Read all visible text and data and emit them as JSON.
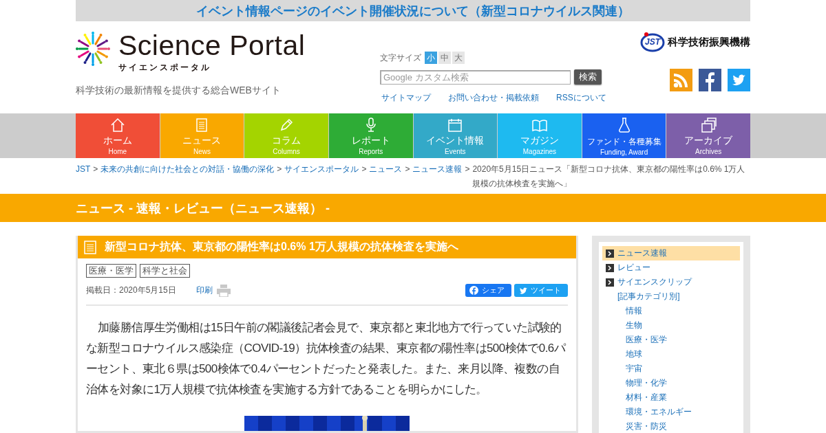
{
  "notice_banner": "イベント情報ページのイベント開催状況について（新型コロナウイルス関連）",
  "header": {
    "logo_title": "Science Portal",
    "logo_subtitle": "サイエンスポータル",
    "tagline": "科学技術の最新情報を提供する総合WEBサイト",
    "org_logo": {
      "mark": "JST",
      "name": "科学技術振興機構"
    },
    "font_size": {
      "label": "文字サイズ",
      "options": [
        {
          "label": "小",
          "selected": true
        },
        {
          "label": "中",
          "selected": false
        },
        {
          "label": "大",
          "selected": false
        }
      ]
    },
    "search": {
      "placeholder": "Google カスタム検索",
      "button": "検索"
    },
    "links": [
      "サイトマップ",
      "お問い合わせ・掲載依頼",
      "RSSについて"
    ]
  },
  "nav": [
    {
      "label": "ホーム",
      "sub": "Home",
      "color": "#f04e37"
    },
    {
      "label": "ニュース",
      "sub": "News",
      "color": "#f9a800"
    },
    {
      "label": "コラム",
      "sub": "Columns",
      "color": "#a4d400"
    },
    {
      "label": "レポート",
      "sub": "Reports",
      "color": "#2eac36"
    },
    {
      "label": "イベント情報",
      "sub": "Events",
      "color": "#33a9c8"
    },
    {
      "label": "マガジン",
      "sub": "Magazines",
      "color": "#1ebaf0"
    },
    {
      "label": "ファンド・各種募集",
      "sub": "Funding, Award",
      "color": "#1a61f0"
    },
    {
      "label": "アーカイブ",
      "sub": "Archives",
      "color": "#7d5fa9"
    }
  ],
  "breadcrumb": {
    "separator": ">",
    "links": [
      "JST",
      "未来の共創に向けた社会との対話・協働の深化",
      "サイエンスポータル",
      "ニュース",
      "ニュース速報"
    ],
    "current": "2020年5月15日ニュース「新型コロナ抗体、東京都の陽性率は0.6% 1万人規模の抗体検査を実施へ」"
  },
  "section_title": "ニュース - 速報・レビュー（ニュース速報） -",
  "article": {
    "title": "新型コロナ抗体、東京都の陽性率は0.6% 1万人規模の抗体検査を実施へ",
    "tags": [
      "医療・医学",
      "科学と社会"
    ],
    "date": "掲載日：2020年5月15日",
    "print": "印刷",
    "share": "シェア",
    "tweet": "ツイート",
    "body": "加藤勝信厚生労働相は15日午前の閣議後記者会見で、東京都と東北地方で行っていた試験的な新型コロナウイルス感染症（COVID-19）抗体検査の結果、東京都の陽性率は500検体で0.6パーセント、東北６県は500検体で0.4パーセントだったと発表した。また、来月以降、複数の自治体を対象に1万人規模で抗体検査を実施する方針であることを明らかにした。",
    "image": {
      "kind": "picture"
    }
  },
  "sidebar": {
    "items": [
      {
        "label": "ニュース速報",
        "selected": true
      },
      {
        "label": "レビュー",
        "selected": false
      },
      {
        "label": "サイエンスクリップ",
        "selected": false
      }
    ],
    "category_heading": "[記事カテゴリ別]",
    "categories": [
      "情報",
      "生物",
      "医療・医学",
      "地球",
      "宇宙",
      "物理・化学",
      "材料・産業",
      "環境・エネルギー",
      "災害・防災"
    ]
  }
}
